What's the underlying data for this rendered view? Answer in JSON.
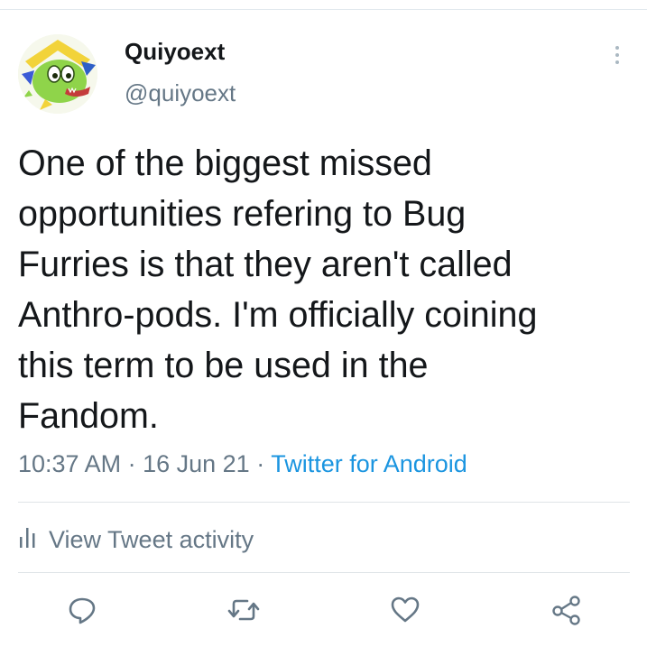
{
  "tweet": {
    "author": {
      "display_name": "Quiyoext",
      "handle": "@quiyoext"
    },
    "text": "One of the biggest missed\nopportunities refering to Bug\nFurries is that they aren't called\nAnthro-pods. I'm officially coining\nthis term to be used in the\nFandom.",
    "time": "10:37 AM",
    "sep1": " · ",
    "date": "16 Jun 21",
    "sep2": " · ",
    "source": "Twitter for Android"
  },
  "activity": {
    "label": "View Tweet activity"
  },
  "actions": [
    {
      "name": "reply",
      "icon": "reply-icon"
    },
    {
      "name": "retweet",
      "icon": "retweet-icon"
    },
    {
      "name": "like",
      "icon": "heart-icon"
    },
    {
      "name": "share",
      "icon": "share-icon"
    }
  ],
  "colors": {
    "text": "#14171a",
    "muted": "#657786",
    "link": "#1b95e0",
    "divider": "#dfe4e8"
  }
}
